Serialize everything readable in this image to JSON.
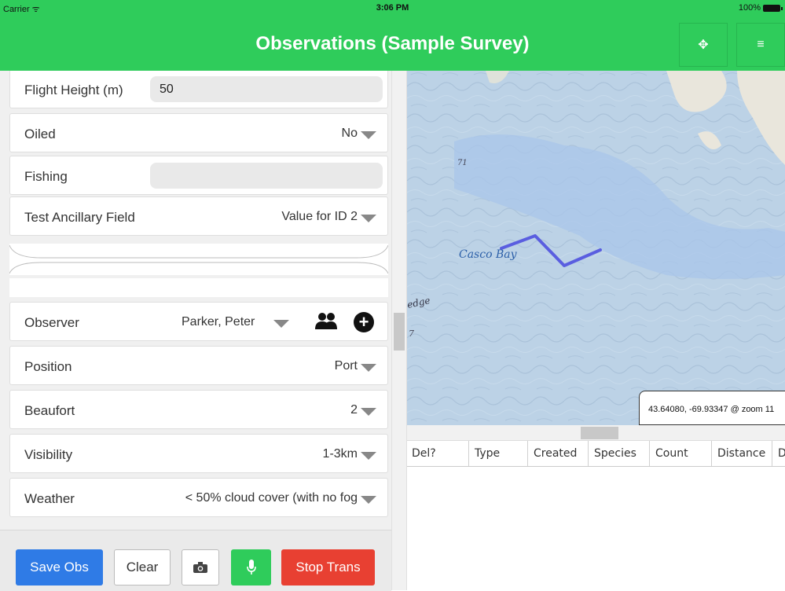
{
  "status_bar": {
    "carrier": "Carrier",
    "time": "3:06 PM",
    "battery": "100%"
  },
  "navbar": {
    "title": "Observations (Sample Survey)",
    "move_icon": "move-arrows-icon",
    "menu_icon": "hamburger-icon"
  },
  "form": {
    "flight_height": {
      "label": "Flight Height (m)",
      "value": "50"
    },
    "oiled": {
      "label": "Oiled",
      "value": "No"
    },
    "fishing": {
      "label": "Fishing",
      "value": ""
    },
    "test_ancillary": {
      "label": "Test Ancillary Field",
      "value": "Value for ID 2"
    },
    "observer": {
      "label": "Observer",
      "value": "Parker, Peter"
    },
    "position": {
      "label": "Position",
      "value": "Port"
    },
    "beaufort": {
      "label": "Beaufort",
      "value": "2"
    },
    "visibility": {
      "label": "Visibility",
      "value": "1-3km"
    },
    "weather": {
      "label": "Weather",
      "value": "< 50% cloud cover (with no fog"
    }
  },
  "actions": {
    "save": "Save Obs",
    "clear": "Clear",
    "stop": "Stop Trans"
  },
  "map": {
    "place_label": "Casco Bay",
    "depth_label_1": "71",
    "depth_label_2": "7",
    "ledge_label": "edge",
    "coordinates": "43.64080, -69.93347 @ zoom 11"
  },
  "table": {
    "columns": [
      "Del?",
      "Type",
      "Created",
      "Species",
      "Count",
      "Distance",
      "D"
    ]
  },
  "colors": {
    "green": "#2fcc5b",
    "blue": "#2f7be6",
    "red": "#e84032",
    "track": "#5a5ee0"
  }
}
